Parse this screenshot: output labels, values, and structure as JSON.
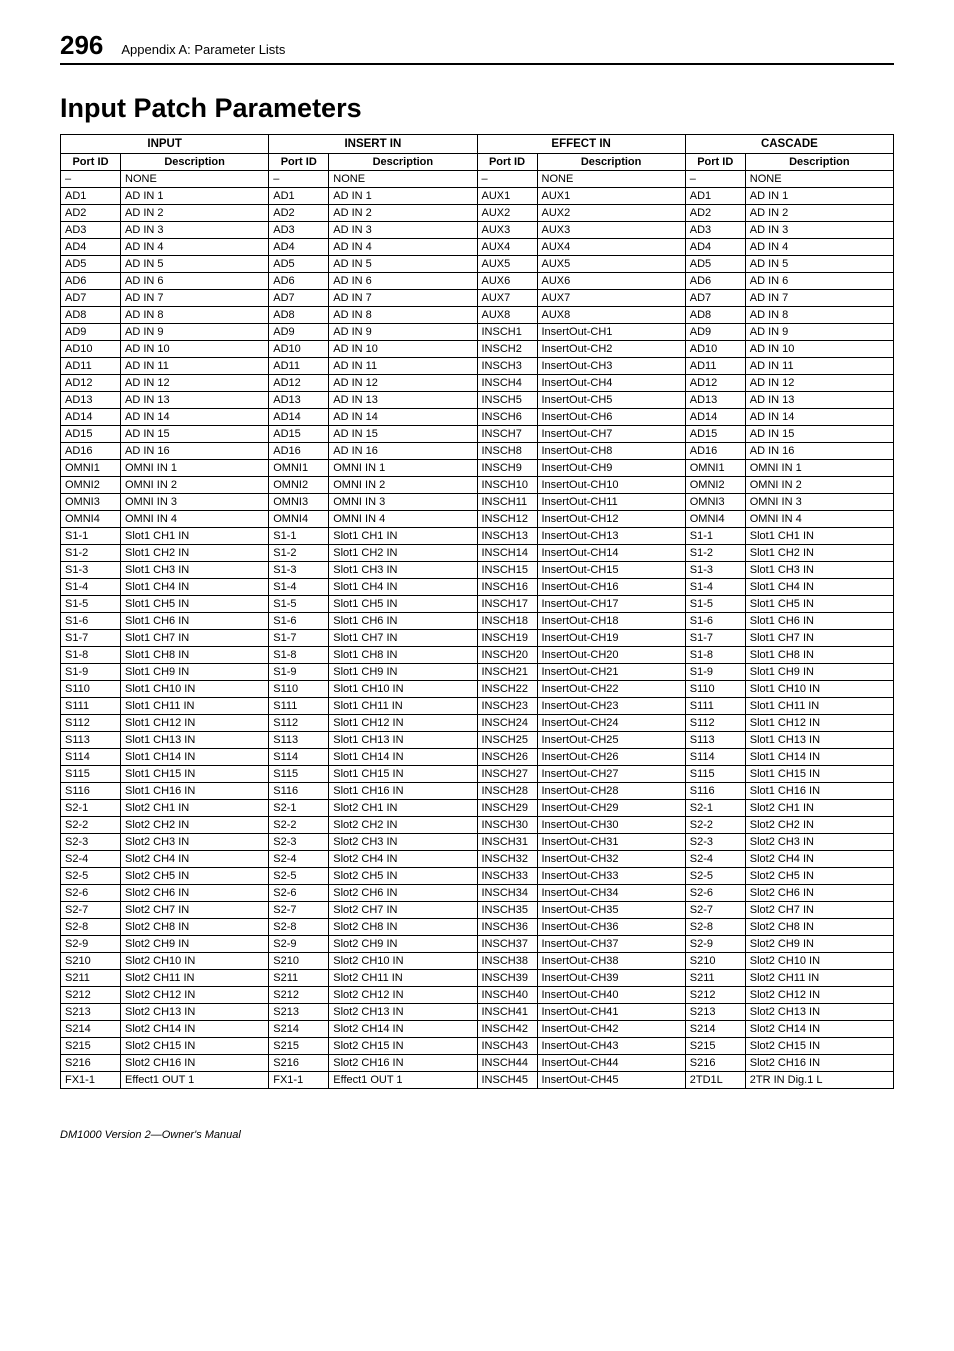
{
  "page_number": "296",
  "appendix_title": "Appendix A: Parameter Lists",
  "main_heading": "Input Patch Parameters",
  "footer": "DM1000 Version 2—Owner's Manual",
  "groups": [
    "INPUT",
    "INSERT IN",
    "EFFECT IN",
    "CASCADE"
  ],
  "subheaders": [
    "Port ID",
    "Description",
    "Port ID",
    "Description",
    "Port ID",
    "Description",
    "Port ID",
    "Description"
  ],
  "rows": [
    [
      "–",
      "NONE",
      "–",
      "NONE",
      "–",
      "NONE",
      "–",
      "NONE"
    ],
    [
      "AD1",
      "AD IN 1",
      "AD1",
      "AD IN 1",
      "AUX1",
      "AUX1",
      "AD1",
      "AD IN 1"
    ],
    [
      "AD2",
      "AD IN 2",
      "AD2",
      "AD IN 2",
      "AUX2",
      "AUX2",
      "AD2",
      "AD IN 2"
    ],
    [
      "AD3",
      "AD IN 3",
      "AD3",
      "AD IN 3",
      "AUX3",
      "AUX3",
      "AD3",
      "AD IN 3"
    ],
    [
      "AD4",
      "AD IN 4",
      "AD4",
      "AD IN 4",
      "AUX4",
      "AUX4",
      "AD4",
      "AD IN 4"
    ],
    [
      "AD5",
      "AD IN 5",
      "AD5",
      "AD IN 5",
      "AUX5",
      "AUX5",
      "AD5",
      "AD IN 5"
    ],
    [
      "AD6",
      "AD IN 6",
      "AD6",
      "AD IN 6",
      "AUX6",
      "AUX6",
      "AD6",
      "AD IN 6"
    ],
    [
      "AD7",
      "AD IN 7",
      "AD7",
      "AD IN 7",
      "AUX7",
      "AUX7",
      "AD7",
      "AD IN 7"
    ],
    [
      "AD8",
      "AD IN 8",
      "AD8",
      "AD IN 8",
      "AUX8",
      "AUX8",
      "AD8",
      "AD IN 8"
    ],
    [
      "AD9",
      "AD IN 9",
      "AD9",
      "AD IN 9",
      "INSCH1",
      "InsertOut-CH1",
      "AD9",
      "AD IN 9"
    ],
    [
      "AD10",
      "AD IN 10",
      "AD10",
      "AD IN 10",
      "INSCH2",
      "InsertOut-CH2",
      "AD10",
      "AD IN 10"
    ],
    [
      "AD11",
      "AD IN 11",
      "AD11",
      "AD IN 11",
      "INSCH3",
      "InsertOut-CH3",
      "AD11",
      "AD IN 11"
    ],
    [
      "AD12",
      "AD IN 12",
      "AD12",
      "AD IN 12",
      "INSCH4",
      "InsertOut-CH4",
      "AD12",
      "AD IN 12"
    ],
    [
      "AD13",
      "AD IN 13",
      "AD13",
      "AD IN 13",
      "INSCH5",
      "InsertOut-CH5",
      "AD13",
      "AD IN 13"
    ],
    [
      "AD14",
      "AD IN 14",
      "AD14",
      "AD IN 14",
      "INSCH6",
      "InsertOut-CH6",
      "AD14",
      "AD IN 14"
    ],
    [
      "AD15",
      "AD IN 15",
      "AD15",
      "AD IN 15",
      "INSCH7",
      "InsertOut-CH7",
      "AD15",
      "AD IN 15"
    ],
    [
      "AD16",
      "AD IN 16",
      "AD16",
      "AD IN 16",
      "INSCH8",
      "InsertOut-CH8",
      "AD16",
      "AD IN 16"
    ],
    [
      "OMNI1",
      "OMNI IN 1",
      "OMNI1",
      "OMNI IN 1",
      "INSCH9",
      "InsertOut-CH9",
      "OMNI1",
      "OMNI IN 1"
    ],
    [
      "OMNI2",
      "OMNI IN 2",
      "OMNI2",
      "OMNI IN 2",
      "INSCH10",
      "InsertOut-CH10",
      "OMNI2",
      "OMNI IN 2"
    ],
    [
      "OMNI3",
      "OMNI IN 3",
      "OMNI3",
      "OMNI IN 3",
      "INSCH11",
      "InsertOut-CH11",
      "OMNI3",
      "OMNI IN 3"
    ],
    [
      "OMNI4",
      "OMNI IN 4",
      "OMNI4",
      "OMNI IN 4",
      "INSCH12",
      "InsertOut-CH12",
      "OMNI4",
      "OMNI IN 4"
    ],
    [
      "S1-1",
      "Slot1 CH1 IN",
      "S1-1",
      "Slot1 CH1 IN",
      "INSCH13",
      "InsertOut-CH13",
      "S1-1",
      "Slot1 CH1 IN"
    ],
    [
      "S1-2",
      "Slot1 CH2 IN",
      "S1-2",
      "Slot1 CH2 IN",
      "INSCH14",
      "InsertOut-CH14",
      "S1-2",
      "Slot1 CH2 IN"
    ],
    [
      "S1-3",
      "Slot1 CH3 IN",
      "S1-3",
      "Slot1 CH3 IN",
      "INSCH15",
      "InsertOut-CH15",
      "S1-3",
      "Slot1 CH3 IN"
    ],
    [
      "S1-4",
      "Slot1 CH4 IN",
      "S1-4",
      "Slot1 CH4 IN",
      "INSCH16",
      "InsertOut-CH16",
      "S1-4",
      "Slot1 CH4 IN"
    ],
    [
      "S1-5",
      "Slot1 CH5 IN",
      "S1-5",
      "Slot1 CH5 IN",
      "INSCH17",
      "InsertOut-CH17",
      "S1-5",
      "Slot1 CH5 IN"
    ],
    [
      "S1-6",
      "Slot1 CH6 IN",
      "S1-6",
      "Slot1 CH6 IN",
      "INSCH18",
      "InsertOut-CH18",
      "S1-6",
      "Slot1 CH6 IN"
    ],
    [
      "S1-7",
      "Slot1 CH7 IN",
      "S1-7",
      "Slot1 CH7 IN",
      "INSCH19",
      "InsertOut-CH19",
      "S1-7",
      "Slot1 CH7 IN"
    ],
    [
      "S1-8",
      "Slot1 CH8 IN",
      "S1-8",
      "Slot1 CH8 IN",
      "INSCH20",
      "InsertOut-CH20",
      "S1-8",
      "Slot1 CH8 IN"
    ],
    [
      "S1-9",
      "Slot1 CH9 IN",
      "S1-9",
      "Slot1 CH9 IN",
      "INSCH21",
      "InsertOut-CH21",
      "S1-9",
      "Slot1 CH9 IN"
    ],
    [
      "S110",
      "Slot1 CH10 IN",
      "S110",
      "Slot1 CH10 IN",
      "INSCH22",
      "InsertOut-CH22",
      "S110",
      "Slot1 CH10 IN"
    ],
    [
      "S111",
      "Slot1 CH11 IN",
      "S111",
      "Slot1 CH11 IN",
      "INSCH23",
      "InsertOut-CH23",
      "S111",
      "Slot1 CH11 IN"
    ],
    [
      "S112",
      "Slot1 CH12 IN",
      "S112",
      "Slot1 CH12 IN",
      "INSCH24",
      "InsertOut-CH24",
      "S112",
      "Slot1 CH12 IN"
    ],
    [
      "S113",
      "Slot1 CH13 IN",
      "S113",
      "Slot1 CH13 IN",
      "INSCH25",
      "InsertOut-CH25",
      "S113",
      "Slot1 CH13 IN"
    ],
    [
      "S114",
      "Slot1 CH14 IN",
      "S114",
      "Slot1 CH14 IN",
      "INSCH26",
      "InsertOut-CH26",
      "S114",
      "Slot1 CH14 IN"
    ],
    [
      "S115",
      "Slot1 CH15 IN",
      "S115",
      "Slot1 CH15 IN",
      "INSCH27",
      "InsertOut-CH27",
      "S115",
      "Slot1 CH15 IN"
    ],
    [
      "S116",
      "Slot1 CH16 IN",
      "S116",
      "Slot1 CH16 IN",
      "INSCH28",
      "InsertOut-CH28",
      "S116",
      "Slot1 CH16 IN"
    ],
    [
      "S2-1",
      "Slot2 CH1 IN",
      "S2-1",
      "Slot2 CH1 IN",
      "INSCH29",
      "InsertOut-CH29",
      "S2-1",
      "Slot2 CH1 IN"
    ],
    [
      "S2-2",
      "Slot2 CH2 IN",
      "S2-2",
      "Slot2 CH2 IN",
      "INSCH30",
      "InsertOut-CH30",
      "S2-2",
      "Slot2 CH2 IN"
    ],
    [
      "S2-3",
      "Slot2 CH3 IN",
      "S2-3",
      "Slot2 CH3 IN",
      "INSCH31",
      "InsertOut-CH31",
      "S2-3",
      "Slot2 CH3 IN"
    ],
    [
      "S2-4",
      "Slot2 CH4 IN",
      "S2-4",
      "Slot2 CH4 IN",
      "INSCH32",
      "InsertOut-CH32",
      "S2-4",
      "Slot2 CH4 IN"
    ],
    [
      "S2-5",
      "Slot2 CH5 IN",
      "S2-5",
      "Slot2 CH5 IN",
      "INSCH33",
      "InsertOut-CH33",
      "S2-5",
      "Slot2 CH5 IN"
    ],
    [
      "S2-6",
      "Slot2 CH6 IN",
      "S2-6",
      "Slot2 CH6 IN",
      "INSCH34",
      "InsertOut-CH34",
      "S2-6",
      "Slot2 CH6 IN"
    ],
    [
      "S2-7",
      "Slot2 CH7 IN",
      "S2-7",
      "Slot2 CH7 IN",
      "INSCH35",
      "InsertOut-CH35",
      "S2-7",
      "Slot2 CH7 IN"
    ],
    [
      "S2-8",
      "Slot2 CH8 IN",
      "S2-8",
      "Slot2 CH8 IN",
      "INSCH36",
      "InsertOut-CH36",
      "S2-8",
      "Slot2 CH8 IN"
    ],
    [
      "S2-9",
      "Slot2 CH9 IN",
      "S2-9",
      "Slot2 CH9 IN",
      "INSCH37",
      "InsertOut-CH37",
      "S2-9",
      "Slot2 CH9 IN"
    ],
    [
      "S210",
      "Slot2 CH10 IN",
      "S210",
      "Slot2 CH10 IN",
      "INSCH38",
      "InsertOut-CH38",
      "S210",
      "Slot2 CH10 IN"
    ],
    [
      "S211",
      "Slot2 CH11 IN",
      "S211",
      "Slot2 CH11 IN",
      "INSCH39",
      "InsertOut-CH39",
      "S211",
      "Slot2 CH11 IN"
    ],
    [
      "S212",
      "Slot2 CH12 IN",
      "S212",
      "Slot2 CH12 IN",
      "INSCH40",
      "InsertOut-CH40",
      "S212",
      "Slot2 CH12 IN"
    ],
    [
      "S213",
      "Slot2 CH13 IN",
      "S213",
      "Slot2 CH13 IN",
      "INSCH41",
      "InsertOut-CH41",
      "S213",
      "Slot2 CH13 IN"
    ],
    [
      "S214",
      "Slot2 CH14 IN",
      "S214",
      "Slot2 CH14 IN",
      "INSCH42",
      "InsertOut-CH42",
      "S214",
      "Slot2 CH14 IN"
    ],
    [
      "S215",
      "Slot2 CH15 IN",
      "S215",
      "Slot2 CH15 IN",
      "INSCH43",
      "InsertOut-CH43",
      "S215",
      "Slot2 CH15 IN"
    ],
    [
      "S216",
      "Slot2 CH16 IN",
      "S216",
      "Slot2 CH16 IN",
      "INSCH44",
      "InsertOut-CH44",
      "S216",
      "Slot2 CH16 IN"
    ],
    [
      "FX1-1",
      "Effect1 OUT 1",
      "FX1-1",
      "Effect1 OUT 1",
      "INSCH45",
      "InsertOut-CH45",
      "2TD1L",
      "2TR IN Dig.1 L"
    ]
  ]
}
